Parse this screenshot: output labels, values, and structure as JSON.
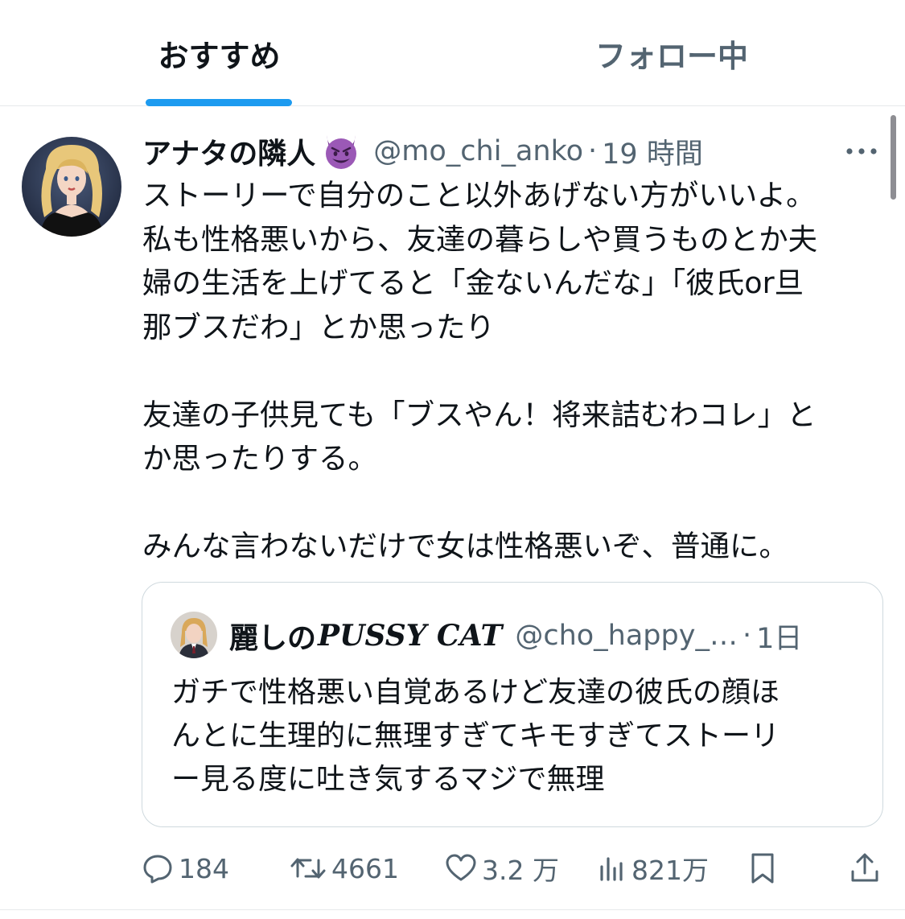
{
  "tabs": {
    "recommended": "おすすめ",
    "following": "フォロー中",
    "active": "recommended"
  },
  "tweet": {
    "display_name": "アナタの隣人",
    "name_emoji": "smiling-imp-icon",
    "handle": "@mo_chi_anko",
    "separator": "·",
    "time": "19 時間",
    "body_lines": [
      "ストーリーで自分のこと以外あげない方がいいよ。",
      "私も性格悪いから、友達の暮らしや買うものとか夫",
      "婦の生活を上げてると「金ないんだな」「彼氏or旦",
      "那ブスだわ」とか思ったり",
      "",
      "友達の子供見ても「ブスやん！将来詰むわコレ」と",
      "か思ったりする。",
      "",
      "みんな言わないだけで女は性格悪いぞ、普通に。"
    ]
  },
  "quote": {
    "display_name_jp": "麗しの",
    "display_name_en": "PUSSY CAT",
    "handle": "@cho_happy_…",
    "separator": "·",
    "time": "1日",
    "body_lines": [
      "ガチで性格悪い自覚あるけど友達の彼氏の顔ほ",
      "んとに生理的に無理すぎてキモすぎてストーリ",
      "ー見る度に吐き気するマジで無理"
    ]
  },
  "actions": {
    "replies": "184",
    "reposts": "4661",
    "likes": "3.2 万",
    "views": "821万"
  },
  "colors": {
    "accent": "#1d9bf0",
    "text": "#0f1419",
    "secondary": "#536471",
    "border": "#cfd9de",
    "emoji_purple": "#9b59b6"
  }
}
